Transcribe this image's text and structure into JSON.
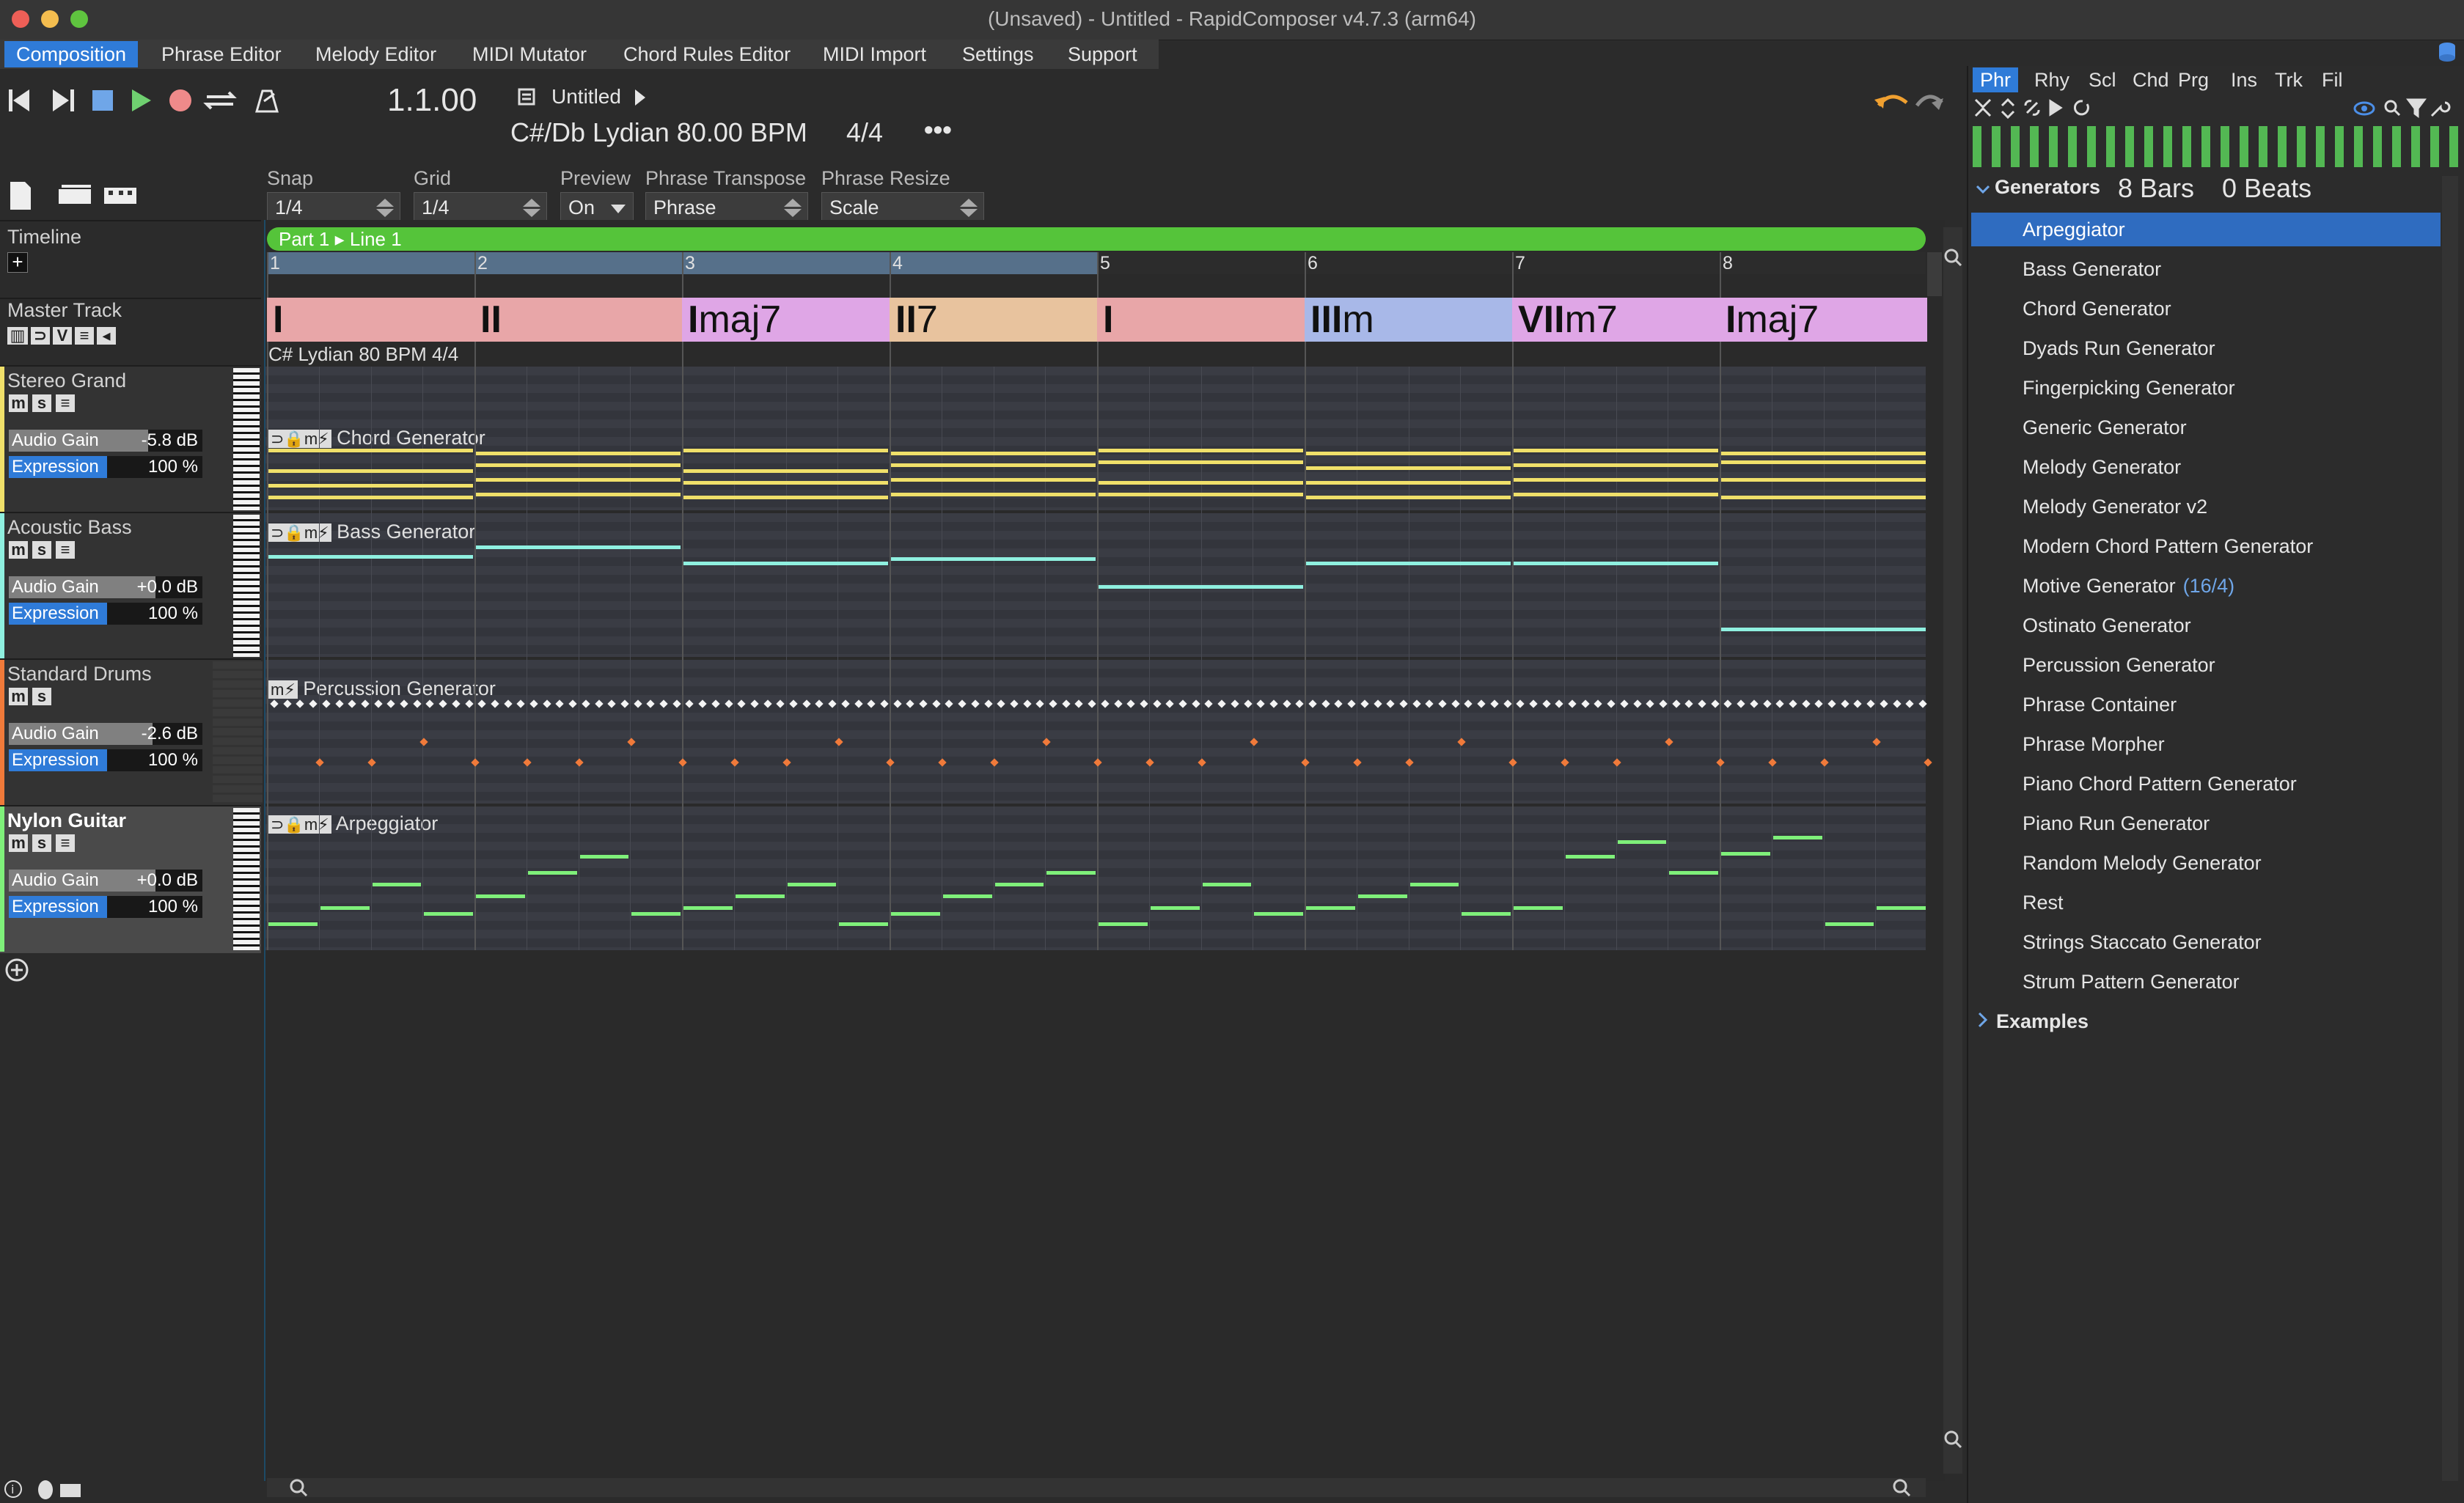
{
  "window": {
    "title": "(Unsaved) - Untitled - RapidComposer v4.7.3 (arm64)"
  },
  "menu": [
    "Composition",
    "Phrase Editor",
    "Melody Editor",
    "MIDI Mutator",
    "Chord Rules Editor",
    "MIDI Import",
    "Settings",
    "Support"
  ],
  "transport": {
    "position": "1.1.00",
    "song_name": "Untitled",
    "key_tempo": "C#/Db Lydian  80.00 BPM",
    "meter": "4/4",
    "more": "•••"
  },
  "controls": {
    "snap": {
      "label": "Snap",
      "value": "1/4"
    },
    "grid": {
      "label": "Grid",
      "value": "1/4"
    },
    "preview": {
      "label": "Preview",
      "value": "On"
    },
    "phrase_transpose": {
      "label": "Phrase Transpose",
      "value": "Phrase"
    },
    "phrase_resize": {
      "label": "Phrase Resize",
      "value": "Scale"
    }
  },
  "timeline": {
    "label": "Timeline",
    "part": "Part 1 ▸ Line 1",
    "bars": [
      "1",
      "2",
      "3",
      "4",
      "5",
      "6",
      "7",
      "8"
    ]
  },
  "master": {
    "label": "Master Track",
    "info": "C# Lydian 80 BPM 4/4",
    "chords": [
      {
        "root": "I",
        "quality": "",
        "color": "#e8a6a8"
      },
      {
        "root": "II",
        "quality": "",
        "color": "#e8a6a8"
      },
      {
        "root": "I",
        "quality": "maj7",
        "color": "#dfa6e6"
      },
      {
        "root": "II",
        "quality": "7",
        "color": "#e8c39e"
      },
      {
        "root": "I",
        "quality": "",
        "color": "#e8a6a8"
      },
      {
        "root": "III",
        "quality": "m",
        "color": "#a8b8e8"
      },
      {
        "root": "VII",
        "quality": "m7",
        "color": "#dfa6e6"
      },
      {
        "root": "I",
        "quality": "maj7",
        "color": "#dfa6e6"
      }
    ]
  },
  "tracks": [
    {
      "name": "Stereo Grand",
      "gain_label": "Audio Gain",
      "gain": "-5.8 dB",
      "expr_label": "Expression",
      "expr": "100 %",
      "phrase": "Chord Generator"
    },
    {
      "name": "Acoustic Bass",
      "gain_label": "Audio Gain",
      "gain": "+0.0 dB",
      "expr_label": "Expression",
      "expr": "100 %",
      "phrase": "Bass Generator"
    },
    {
      "name": "Standard Drums",
      "gain_label": "Audio Gain",
      "gain": "-2.6 dB",
      "expr_label": "Expression",
      "expr": "100 %",
      "phrase": "Percussion Generator"
    },
    {
      "name": "Nylon Guitar",
      "gain_label": "Audio Gain",
      "gain": "+0.0 dB",
      "expr_label": "Expression",
      "expr": "100 %",
      "phrase": "Arpeggiator"
    }
  ],
  "track_buttons": {
    "m": "m",
    "s": "s",
    "v": "V"
  },
  "panel": {
    "tabs": [
      "Phr",
      "Rhy",
      "Scl",
      "Chd",
      "Prg",
      "Ins",
      "Trk",
      "Fil"
    ],
    "section": "Generators",
    "length_bars": "8 Bars",
    "length_beats": "0 Beats",
    "items": [
      {
        "name": "Arpeggiator",
        "extra": ""
      },
      {
        "name": "Bass Generator",
        "extra": ""
      },
      {
        "name": "Chord Generator",
        "extra": ""
      },
      {
        "name": "Dyads Run Generator",
        "extra": ""
      },
      {
        "name": "Fingerpicking Generator",
        "extra": ""
      },
      {
        "name": "Generic Generator",
        "extra": ""
      },
      {
        "name": "Melody Generator",
        "extra": ""
      },
      {
        "name": "Melody Generator v2",
        "extra": ""
      },
      {
        "name": "Modern Chord Pattern Generator",
        "extra": ""
      },
      {
        "name": "Motive Generator",
        "extra": "(16/4)"
      },
      {
        "name": "Ostinato Generator",
        "extra": ""
      },
      {
        "name": "Percussion Generator",
        "extra": ""
      },
      {
        "name": "Phrase Container",
        "extra": ""
      },
      {
        "name": "Phrase Morpher",
        "extra": ""
      },
      {
        "name": "Piano Chord Pattern Generator",
        "extra": ""
      },
      {
        "name": "Piano Run Generator",
        "extra": ""
      },
      {
        "name": "Random Melody Generator",
        "extra": ""
      },
      {
        "name": "Rest",
        "extra": ""
      },
      {
        "name": "Strings Staccato Generator",
        "extra": ""
      },
      {
        "name": "Strum Pattern Generator",
        "extra": ""
      }
    ],
    "examples": "Examples"
  },
  "colors": {
    "accent": "#2f7bd8",
    "timeline_green": "#55c43a",
    "chord_note": "#f0e06a",
    "bass_note": "#8ff0e0",
    "guitar_note": "#7ff07a",
    "drum_hit": "#f07a3a"
  }
}
